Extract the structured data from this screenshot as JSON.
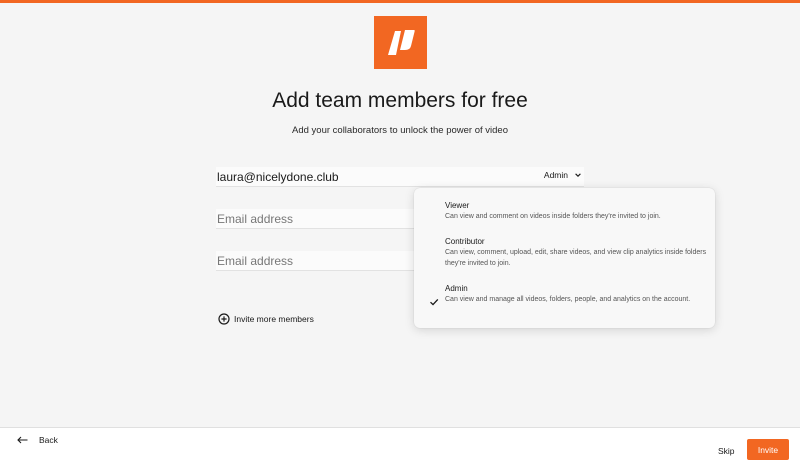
{
  "brand": {
    "accent": "#f26722"
  },
  "header": {
    "title": "Add team members for free",
    "subtitle": "Add your collaborators to unlock the power of video"
  },
  "invites": [
    {
      "value": "laura@nicelydone.club",
      "role": "Admin"
    },
    {
      "placeholder": "Email address"
    },
    {
      "placeholder": "Email address"
    }
  ],
  "invite_more_label": "Invite more members",
  "role_dropdown": {
    "options": [
      {
        "title": "Viewer",
        "description": "Can view and comment on videos inside folders they're invited to join."
      },
      {
        "title": "Contributor",
        "description": "Can view, comment, upload, edit, share videos, and view clip analytics inside folders they're invited to join."
      },
      {
        "title": "Admin",
        "description": "Can view and manage all videos, folders, people, and analytics on the account.",
        "selected": true
      }
    ]
  },
  "footer": {
    "back_label": "Back",
    "skip_label": "Skip",
    "invite_label": "Invite"
  }
}
